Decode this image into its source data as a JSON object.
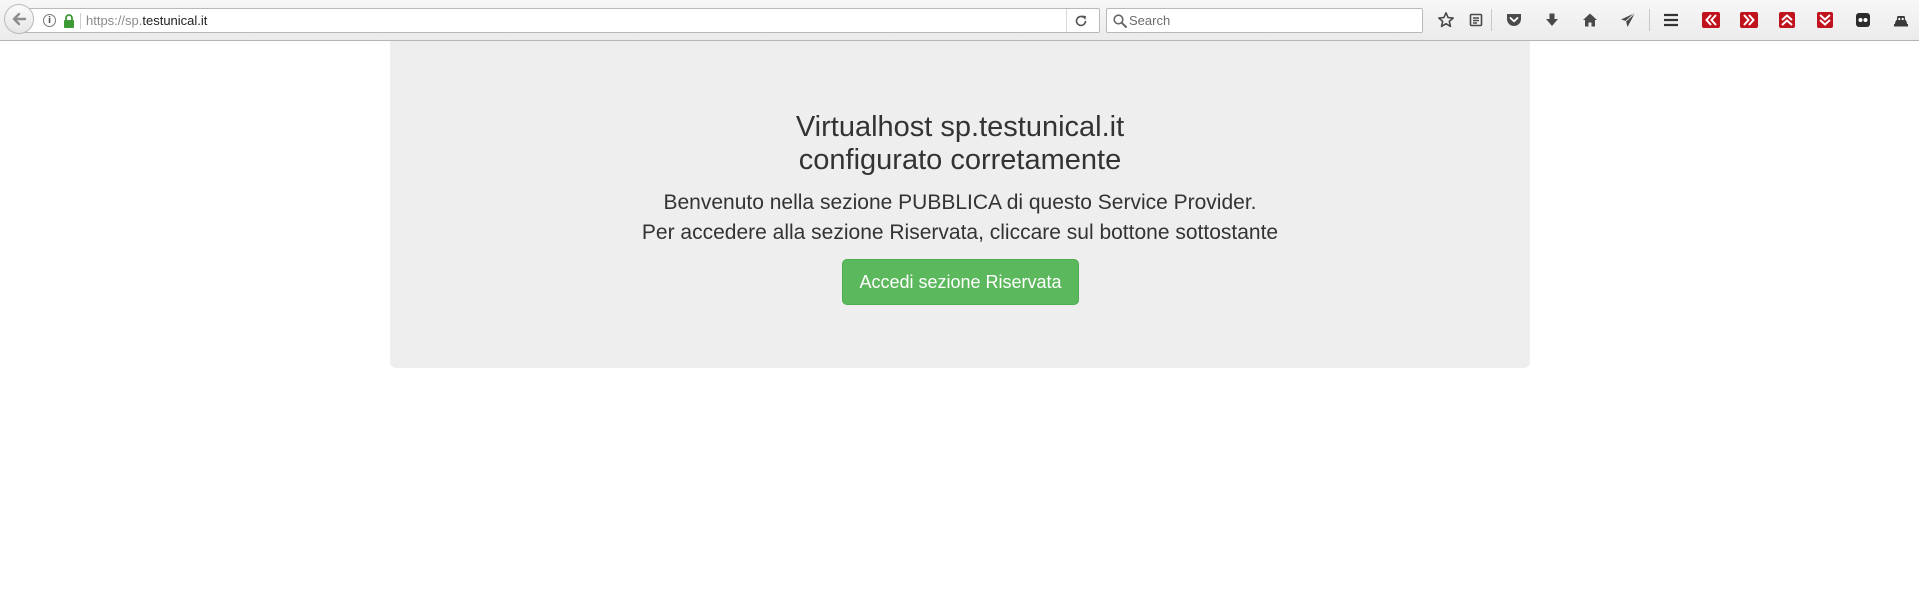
{
  "browser": {
    "url_scheme": "https://sp.",
    "url_host": "testunical.it",
    "search_placeholder": "Search"
  },
  "toolbar_icons": [
    "star-icon",
    "reading-list-icon",
    "pocket-icon",
    "download-icon",
    "home-icon",
    "send-tab-icon",
    "menu-icon",
    "addon-prev-icon",
    "addon-next-icon",
    "addon-up-icon",
    "addon-down-icon",
    "addon-mask-icon",
    "addon-robot-icon"
  ],
  "main": {
    "title_line1": "Virtualhost sp.testunical.it",
    "title_line2": "configurato corretamente",
    "lead_line1": "Benvenuto nella sezione PUBBLICA di questo Service Provider.",
    "lead_line2": "Per accedere alla sezione Riservata, cliccare sul bottone sottostante",
    "button_label": "Accedi sezione Riservata"
  },
  "colors": {
    "jumbotron_bg": "#eeeeee",
    "button_bg": "#5cb85c",
    "addon_red": "#c1131d",
    "lock_green": "#3c9a35"
  }
}
